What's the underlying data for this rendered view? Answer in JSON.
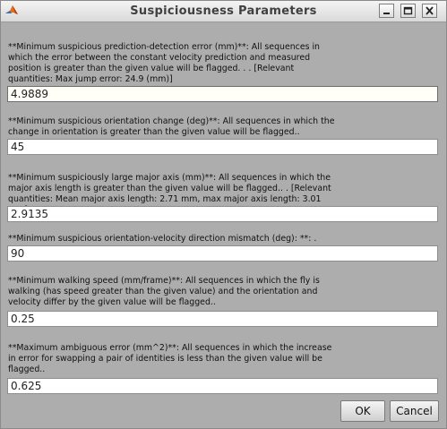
{
  "window": {
    "title": "Suspiciousness Parameters"
  },
  "params": [
    {
      "label": "**Minimum suspicious prediction-detection error (mm)**: All sequences in which the error between the constant velocity prediction and measured position is greater than the given value will be flagged. . . [Relevant quantities: Max jump error: 24.9 (mm)]",
      "value": "4.9889"
    },
    {
      "label": "**Minimum suspicious orientation change (deg)**: All sequences in which the change in orientation is greater than the given value will be flagged..",
      "value": "45"
    },
    {
      "label": "**Minimum suspiciously large major axis (mm)**: All sequences in which the major axis length is greater than the given value will be flagged.. . [Relevant quantities: Mean major axis length: 2.71 mm, max major axis length: 3.01 mm]",
      "value": "2.9135"
    },
    {
      "label": "**Minimum suspicious orientation-velocity direction mismatch (deg): **: .",
      "value": "90"
    },
    {
      "label": "**Minimum walking speed (mm/frame)**: All sequences in which the fly is walking (has speed greater than the given value) and the orientation and velocity differ by the given value will be flagged..",
      "value": "0.25"
    },
    {
      "label": "**Maximum ambiguous error (mm^2)**: All sequences in which the increase in error for swapping a pair of identities is less than the given value will be flagged..",
      "value": "0.625"
    }
  ],
  "buttons": {
    "ok": "OK",
    "cancel": "Cancel"
  }
}
